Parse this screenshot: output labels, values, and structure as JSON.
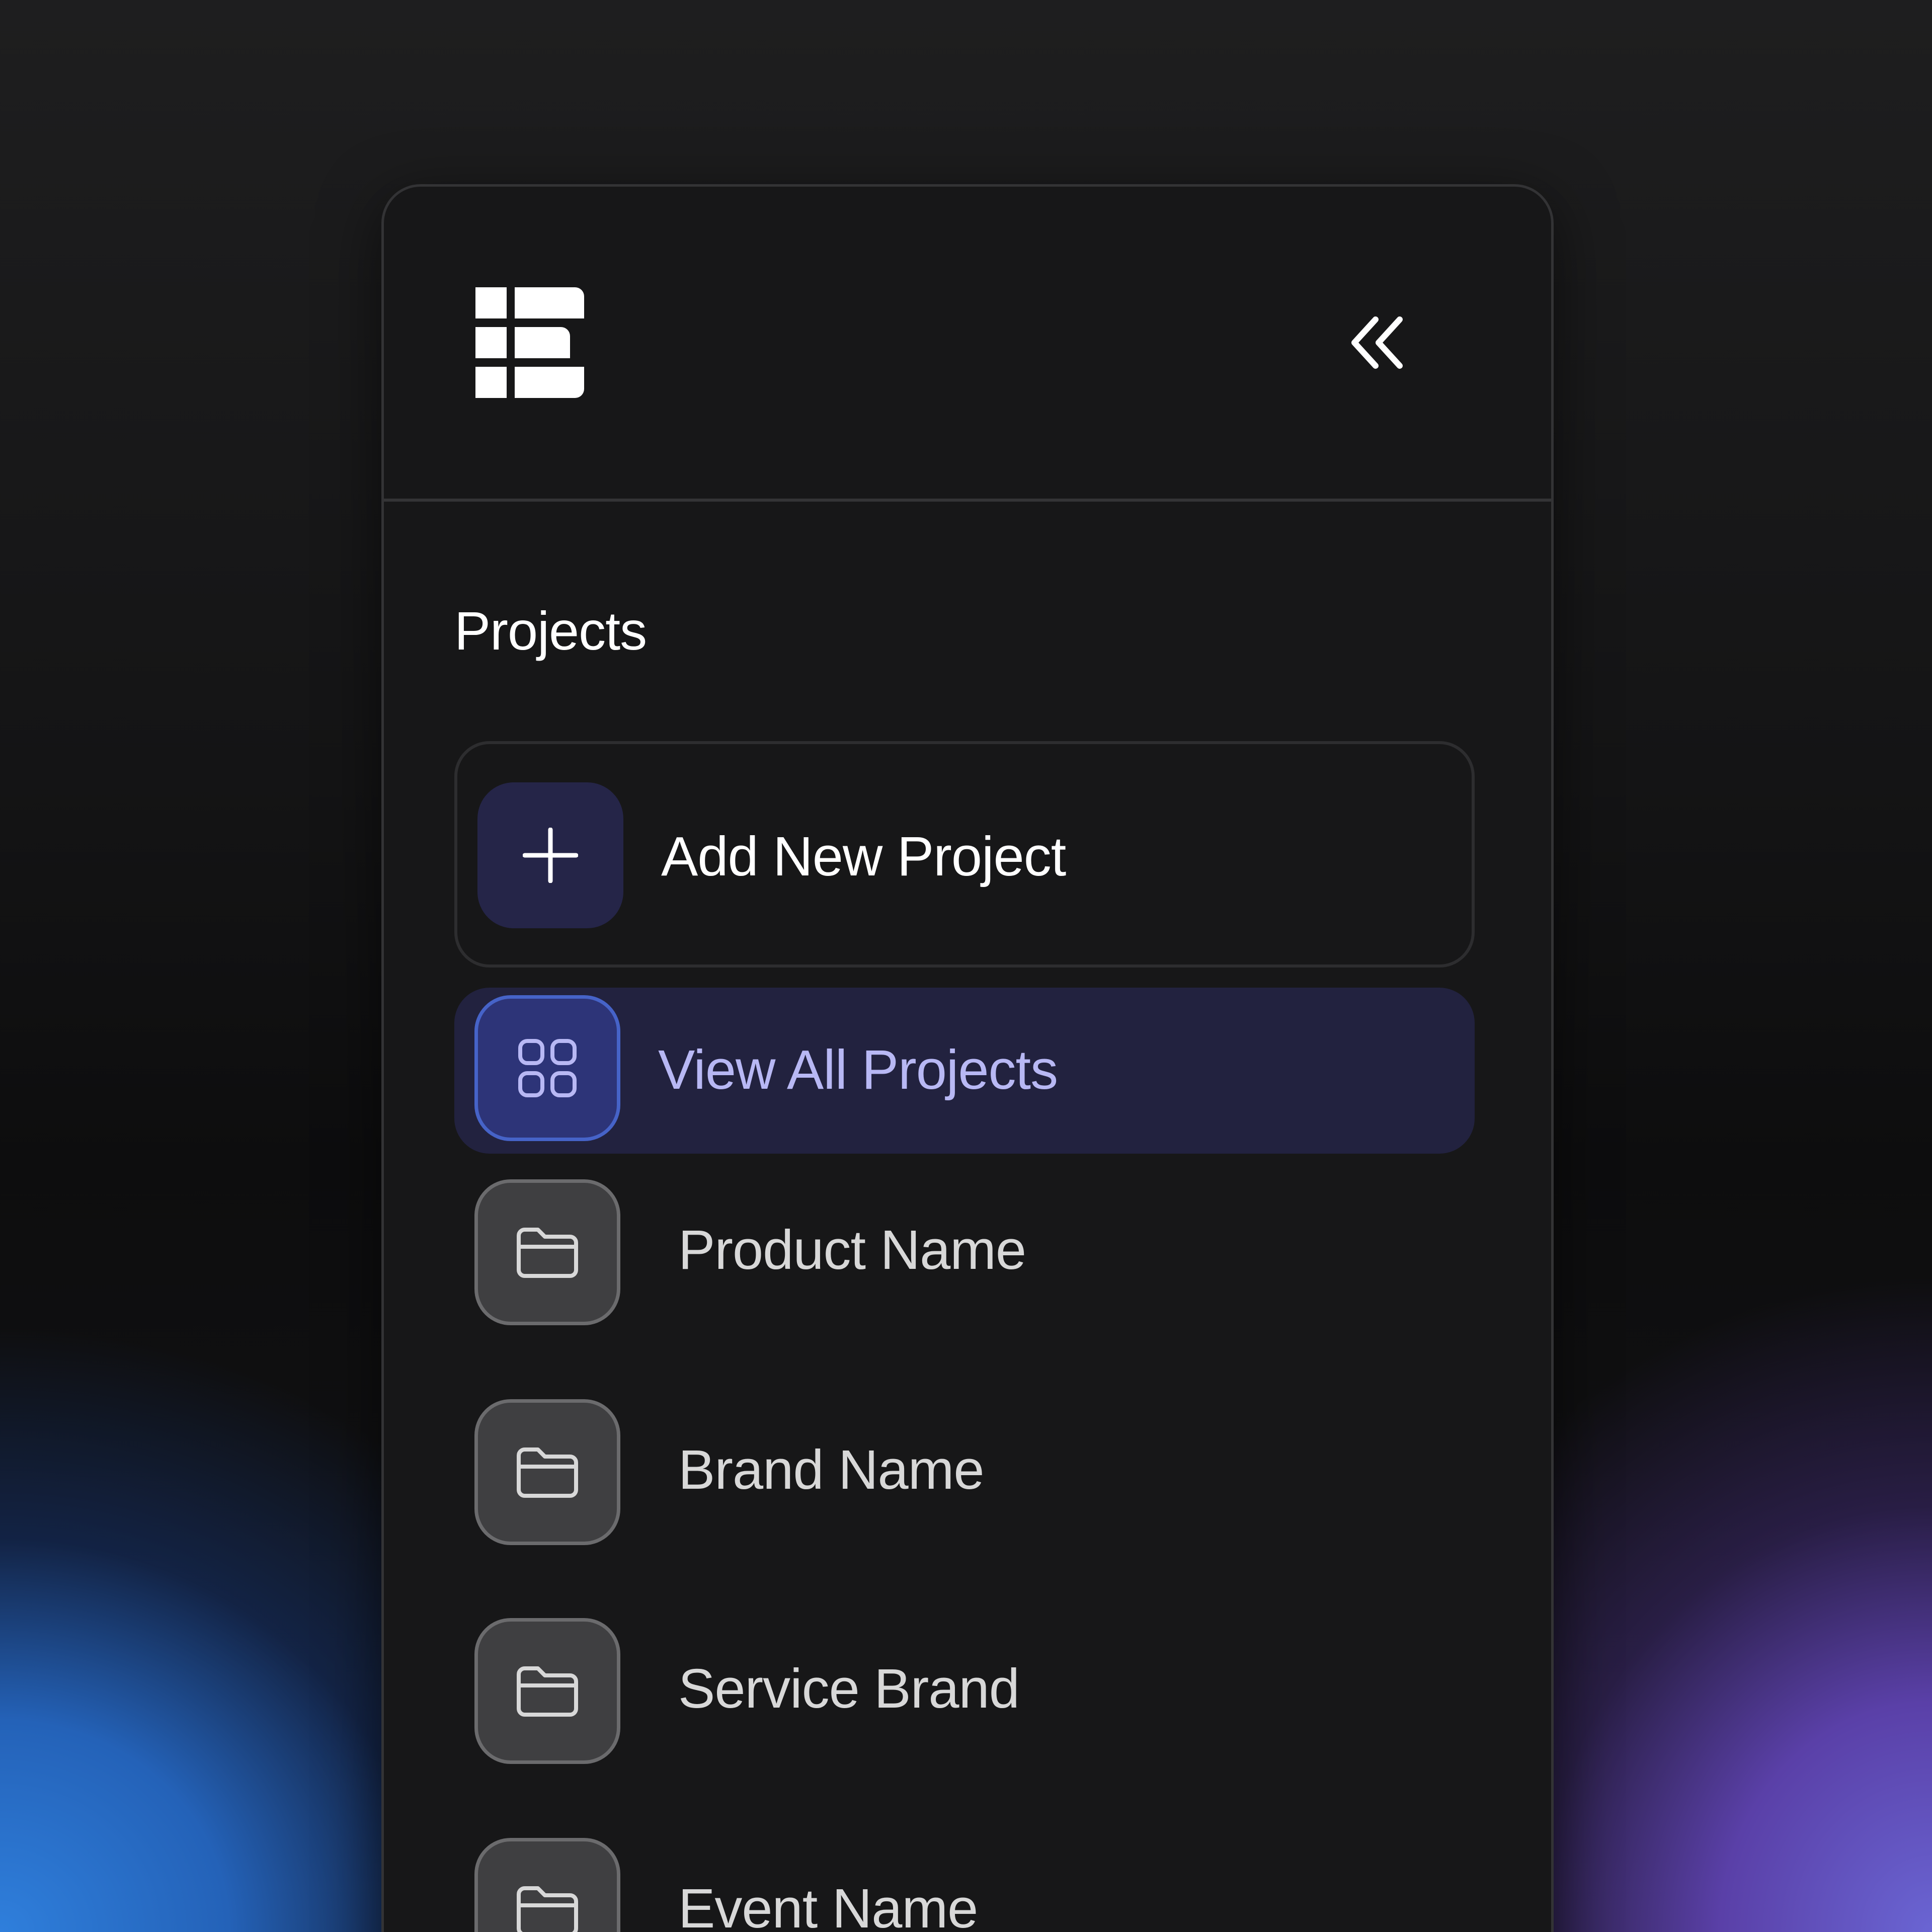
{
  "sidebar": {
    "logo_icon": "stacked-bars-logo-icon",
    "collapse_icon": "chevrons-left-icon",
    "section_title": "Projects",
    "add_project": {
      "label": "Add New Project",
      "icon": "plus-icon"
    },
    "view_all": {
      "label": "View All Projects",
      "icon": "grid-icon",
      "active": true,
      "accent_color": "#b8b8f4"
    },
    "projects": [
      {
        "label": "Product Name",
        "icon": "folder-icon"
      },
      {
        "label": "Brand Name",
        "icon": "folder-icon"
      },
      {
        "label": "Service Brand",
        "icon": "folder-icon"
      },
      {
        "label": "Event Name",
        "icon": "folder-icon"
      }
    ]
  },
  "colors": {
    "panel_background": "#171718",
    "active_item_background": "#22223f",
    "active_tile_background": "#2d3478",
    "active_tile_border": "#4663c8"
  }
}
